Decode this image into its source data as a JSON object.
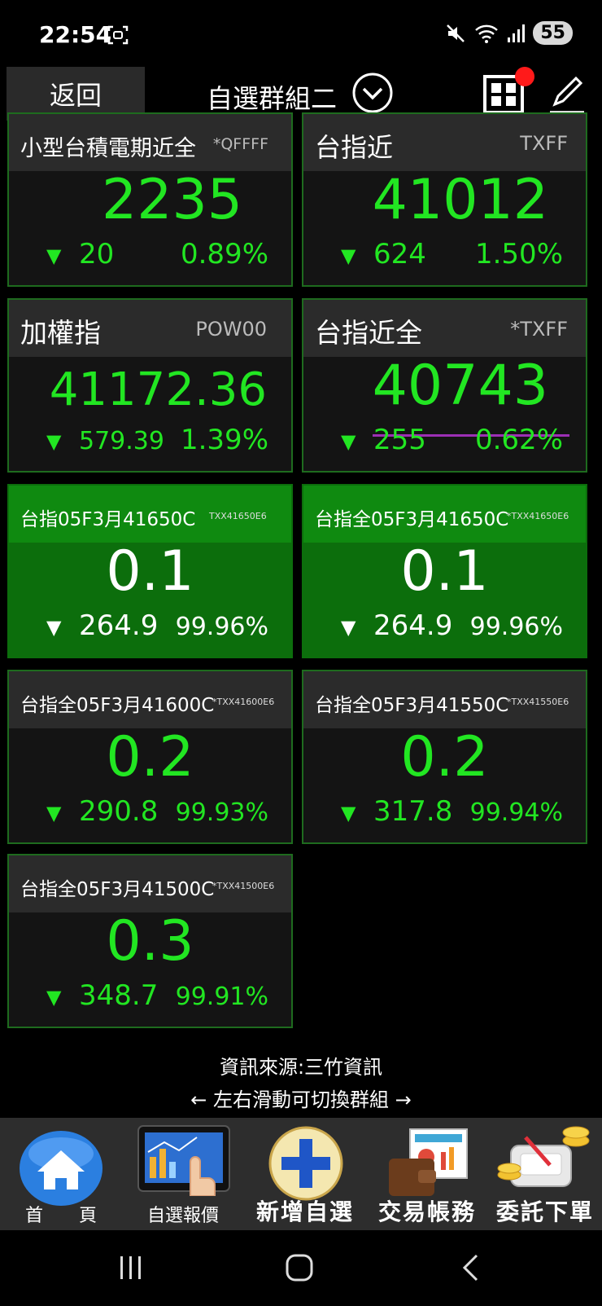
{
  "status_bar": {
    "time": "22:54",
    "battery": "55",
    "icons": [
      "screenshot-icon",
      "mute-icon",
      "wifi-icon",
      "signal-icon"
    ]
  },
  "header": {
    "back_label": "返回",
    "group_title": "自選群組二",
    "icons": [
      "chevron-down-icon",
      "grid-icon",
      "edit-icon"
    ]
  },
  "tiles": [
    {
      "name": "小型台積電期近全",
      "code": "*QFFFF",
      "value": "2235",
      "arrow": "▼",
      "change": "20",
      "percent": "0.89%"
    },
    {
      "name": "台指近",
      "code": "TXFF",
      "value": "41012",
      "arrow": "▼",
      "change": "624",
      "percent": "1.50%"
    },
    {
      "name": "加權指",
      "code": "POW00",
      "value": "41172.36",
      "arrow": "▼",
      "change": "579.39",
      "percent": "1.39%"
    },
    {
      "name": "台指近全",
      "code": "*TXFF",
      "value": "40743",
      "arrow": "▼",
      "change": "255",
      "percent": "0.62%"
    },
    {
      "name": "台指05F3月41650C",
      "code": "TXX41650E6",
      "value": "0.1",
      "arrow": "▼",
      "change": "264.9",
      "percent": "99.96%"
    },
    {
      "name": "台指全05F3月41650C",
      "code": "*TXX41650E6",
      "value": "0.1",
      "arrow": "▼",
      "change": "264.9",
      "percent": "99.96%"
    },
    {
      "name": "台指全05F3月41600C",
      "code": "*TXX41600E6",
      "value": "0.2",
      "arrow": "▼",
      "change": "290.8",
      "percent": "99.93%"
    },
    {
      "name": "台指全05F3月41550C",
      "code": "*TXX41550E6",
      "value": "0.2",
      "arrow": "▼",
      "change": "317.8",
      "percent": "99.94%"
    },
    {
      "name": "台指全05F3月41500C",
      "code": "*TXX41500E6",
      "value": "0.3",
      "arrow": "▼",
      "change": "348.7",
      "percent": "99.91%"
    }
  ],
  "footer": {
    "source": "資訊來源:三竹資訊",
    "swipe_hint": "← 左右滑動可切換群組 →"
  },
  "bottom_nav": [
    {
      "label": "首　　頁",
      "icon": "home-icon"
    },
    {
      "label": "自選報價",
      "icon": "quote-tablet-icon"
    },
    {
      "label": "新增自選",
      "icon": "add-icon"
    },
    {
      "label": "交易帳務",
      "icon": "wallet-icon"
    },
    {
      "label": "委託下單",
      "icon": "coins-order-icon"
    }
  ],
  "system_nav": [
    "recents-icon",
    "home-button-icon",
    "back-icon"
  ],
  "colors": {
    "up_down_green": "#22e622",
    "highlight_tile": "#0c6e0c",
    "tile_bg": "#141414",
    "notification": "#ff1a1a",
    "indicator_line": "#9c2fb5"
  }
}
